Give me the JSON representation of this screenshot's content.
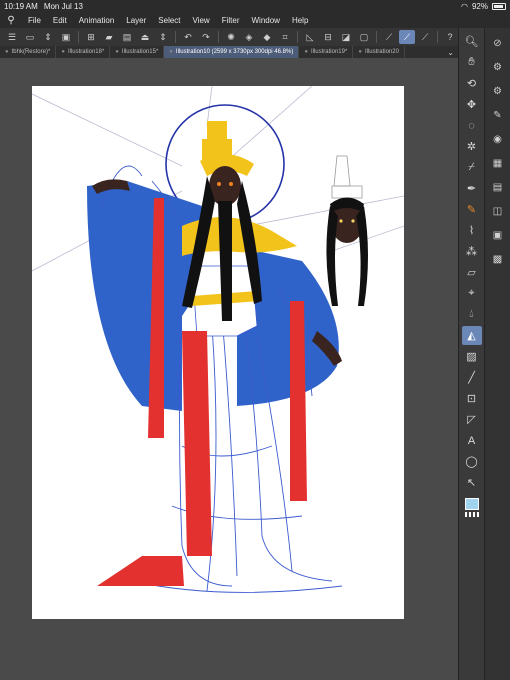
{
  "status": {
    "time": "10:19 AM",
    "date": "Mon Jul 13",
    "battery": "92%",
    "wifi_icon": "wifi-icon"
  },
  "menu": {
    "items": [
      "File",
      "Edit",
      "Animation",
      "Layer",
      "Select",
      "View",
      "Filter",
      "Window",
      "Help"
    ]
  },
  "tabs": [
    {
      "label": "tbhk(Restore)*"
    },
    {
      "label": "Illustration18*"
    },
    {
      "label": "Illustration15*"
    },
    {
      "label": "Illustration10 (2599 x 3730px 300dpi 46.8%)"
    },
    {
      "label": "Illustration19*"
    },
    {
      "label": "Illustration20"
    }
  ],
  "colors": {
    "accent": "#6a87b8",
    "fg_color": "#9fd3f0",
    "robe_blue": "#2f63c9",
    "ribbon_red": "#e3312f",
    "gold": "#f2c41b"
  }
}
